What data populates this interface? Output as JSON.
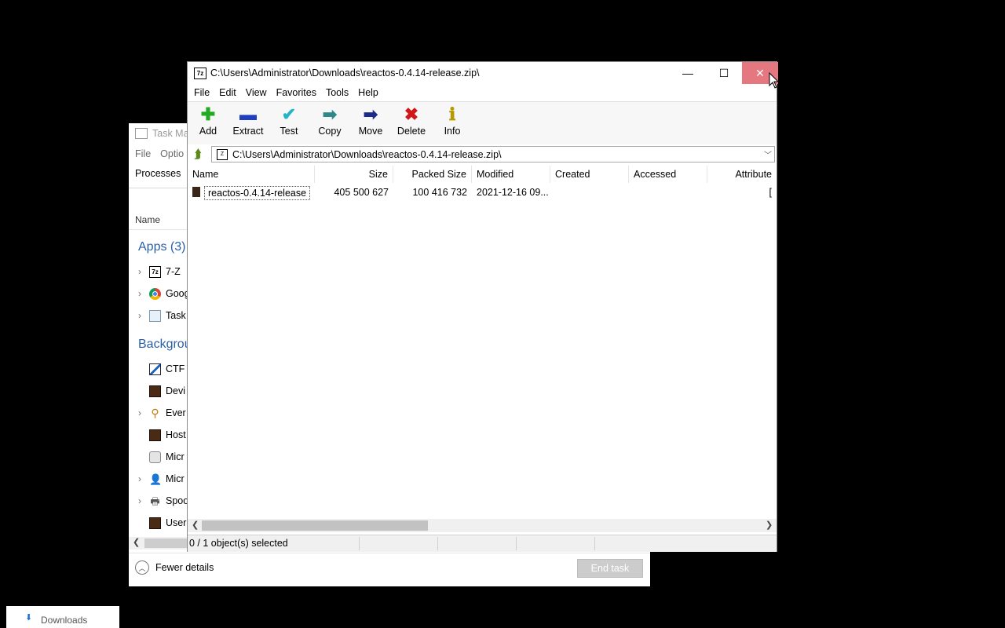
{
  "task_manager": {
    "title": "Task Ma",
    "menu": [
      "File",
      "Optio"
    ],
    "tab_processes": "Processes",
    "col_name": "Name",
    "apps_group": "Apps (3)",
    "background_group": "Backgrou",
    "apps": [
      {
        "label": "7-Z",
        "icon": "7zip-icon",
        "expandable": true
      },
      {
        "label": "Goog",
        "icon": "chrome-icon",
        "expandable": true
      },
      {
        "label": "Task",
        "icon": "task-manager-icon",
        "expandable": true
      }
    ],
    "background": [
      {
        "label": "CTF",
        "icon": "ctf-loader-icon",
        "expandable": false
      },
      {
        "label": "Devi",
        "icon": "process-icon",
        "expandable": false
      },
      {
        "label": "Ever",
        "icon": "search-icon",
        "expandable": true
      },
      {
        "label": "Host",
        "icon": "process-icon",
        "expandable": false
      },
      {
        "label": "Micr",
        "icon": "component-icon",
        "expandable": false
      },
      {
        "label": "Micr",
        "icon": "user-icon",
        "expandable": true
      },
      {
        "label": "Spoo",
        "icon": "printer-icon",
        "expandable": true
      },
      {
        "label": "User",
        "icon": "process-icon",
        "expandable": false
      }
    ],
    "fewer_details": "Fewer details",
    "end_task": "End task"
  },
  "taskbar": {
    "downloads_label": "Downloads"
  },
  "sevenzip": {
    "app_icon_text": "7z",
    "title": "C:\\Users\\Administrator\\Downloads\\reactos-0.4.14-release.zip\\",
    "window_buttons": {
      "minimize": "—",
      "maximize": "☐",
      "close": "✕"
    },
    "menu": [
      "File",
      "Edit",
      "View",
      "Favorites",
      "Tools",
      "Help"
    ],
    "toolbar": [
      {
        "label": "Add",
        "glyph": "✚",
        "color": "#22aa22",
        "icon": "add-icon"
      },
      {
        "label": "Extract",
        "glyph": "▬",
        "color": "#1f3fbf",
        "icon": "extract-icon"
      },
      {
        "label": "Test",
        "glyph": "✔",
        "color": "#22b5c8",
        "icon": "test-icon"
      },
      {
        "label": "Copy",
        "glyph": "➡",
        "color": "#2e8a8a",
        "icon": "copy-icon"
      },
      {
        "label": "Move",
        "glyph": "➡",
        "color": "#1a2b8c",
        "icon": "move-icon"
      },
      {
        "label": "Delete",
        "glyph": "✖",
        "color": "#d01818",
        "icon": "delete-icon"
      },
      {
        "label": "Info",
        "glyph": "ℹ",
        "color": "#b39a00",
        "icon": "info-icon"
      }
    ],
    "address": "C:\\Users\\Administrator\\Downloads\\reactos-0.4.14-release.zip\\",
    "columns": [
      "Name",
      "Size",
      "Packed Size",
      "Modified",
      "Created",
      "Accessed",
      "Attribute"
    ],
    "files": [
      {
        "name": "reactos-0.4.14-release",
        "size": "405 500 627",
        "packed": "100 416 732",
        "modified": "2021-12-16 09...",
        "created": "",
        "accessed": "",
        "attr": "["
      }
    ],
    "status": "0 / 1 object(s) selected"
  }
}
